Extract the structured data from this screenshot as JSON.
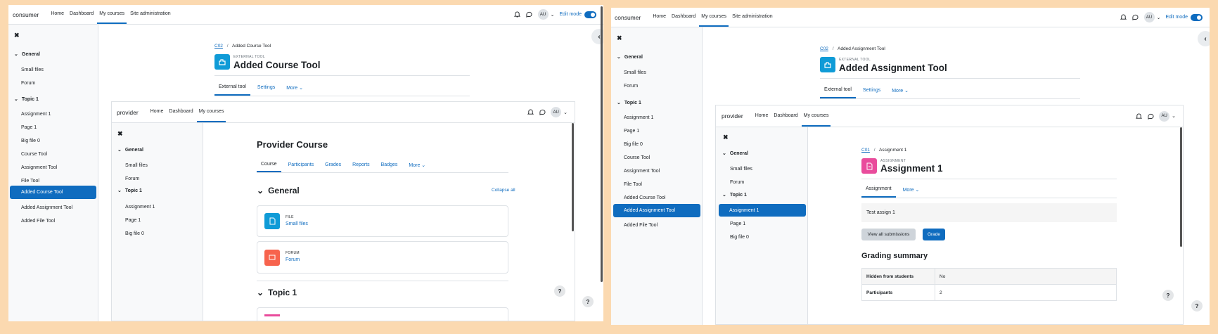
{
  "left": {
    "brand": "consumer",
    "nav": [
      "Home",
      "Dashboard",
      "My courses",
      "Site administration"
    ],
    "nav_active": 2,
    "avatar": "AU",
    "edit_mode": "Edit mode",
    "drawer": {
      "close": "✖",
      "sections": [
        {
          "title": "General",
          "items": [
            "Small files",
            "Forum"
          ]
        },
        {
          "title": "Topic 1",
          "items": [
            "Assignment 1",
            "Page 1",
            "Big file 0",
            "Course Tool",
            "Assignment Tool",
            "File Tool",
            "Added Course Tool",
            "Added Assignment Tool",
            "Added File Tool"
          ]
        }
      ],
      "active": "Added Course Tool"
    },
    "breadcrumb": {
      "link": "C02",
      "current": "Added Course Tool"
    },
    "activity_type": "EXTERNAL TOOL",
    "title": "Added Course Tool",
    "tabs": [
      "External tool",
      "Settings",
      "More ⌄"
    ],
    "iframe": {
      "brand": "provider",
      "nav": [
        "Home",
        "Dashboard",
        "My courses"
      ],
      "avatar": "AU",
      "drawer": {
        "close": "✖",
        "sections": [
          {
            "title": "General",
            "items": [
              "Small files",
              "Forum"
            ]
          },
          {
            "title": "Topic 1",
            "items": [
              "Assignment 1",
              "Page 1",
              "Big file 0"
            ]
          }
        ]
      },
      "course_title": "Provider Course",
      "tabs": [
        "Course",
        "Participants",
        "Grades",
        "Reports",
        "Badges",
        "More ⌄"
      ],
      "section1": "General",
      "collapse_all": "Collapse all",
      "activities": [
        {
          "type": "FILE",
          "name": "Small files",
          "color": "#0f9bd7"
        },
        {
          "type": "FORUM",
          "name": "Forum",
          "color": "#f7634d"
        }
      ],
      "section2": "Topic 1",
      "help": "?"
    },
    "help": "?"
  },
  "right": {
    "brand": "consumer",
    "nav": [
      "Home",
      "Dashboard",
      "My courses",
      "Site administration"
    ],
    "nav_active": 2,
    "avatar": "AU",
    "edit_mode": "Edit mode",
    "drawer": {
      "close": "✖",
      "sections": [
        {
          "title": "General",
          "items": [
            "Small files",
            "Forum"
          ]
        },
        {
          "title": "Topic 1",
          "items": [
            "Assignment 1",
            "Page 1",
            "Big file 0",
            "Course Tool",
            "Assignment Tool",
            "File Tool",
            "Added Course Tool",
            "Added Assignment Tool",
            "Added File Tool"
          ]
        }
      ],
      "active": "Added Assignment Tool"
    },
    "breadcrumb": {
      "link": "C02",
      "current": "Added Assignment Tool"
    },
    "activity_type": "EXTERNAL TOOL",
    "title": "Added Assignment Tool",
    "tabs": [
      "External tool",
      "Settings",
      "More ⌄"
    ],
    "iframe": {
      "brand": "provider",
      "nav": [
        "Home",
        "Dashboard",
        "My courses"
      ],
      "avatar": "AU",
      "drawer": {
        "close": "✖",
        "sections": [
          {
            "title": "General",
            "items": [
              "Small files",
              "Forum"
            ]
          },
          {
            "title": "Topic 1",
            "items": [
              "Assignment 1",
              "Page 1",
              "Big file 0"
            ]
          }
        ],
        "active": "Assignment 1"
      },
      "breadcrumb": {
        "link": "C01",
        "current": "Assignment 1"
      },
      "activity_type": "ASSIGNMENT",
      "title": "Assignment 1",
      "tabs": [
        "Assignment",
        "More ⌄"
      ],
      "intro": "Test assign 1",
      "view_all": "View all submissions",
      "grade": "Grade",
      "grading_summary": "Grading summary",
      "summary_rows": [
        [
          "Hidden from students",
          "No"
        ],
        [
          "Participants",
          "2"
        ]
      ],
      "help": "?"
    },
    "help": "?"
  }
}
